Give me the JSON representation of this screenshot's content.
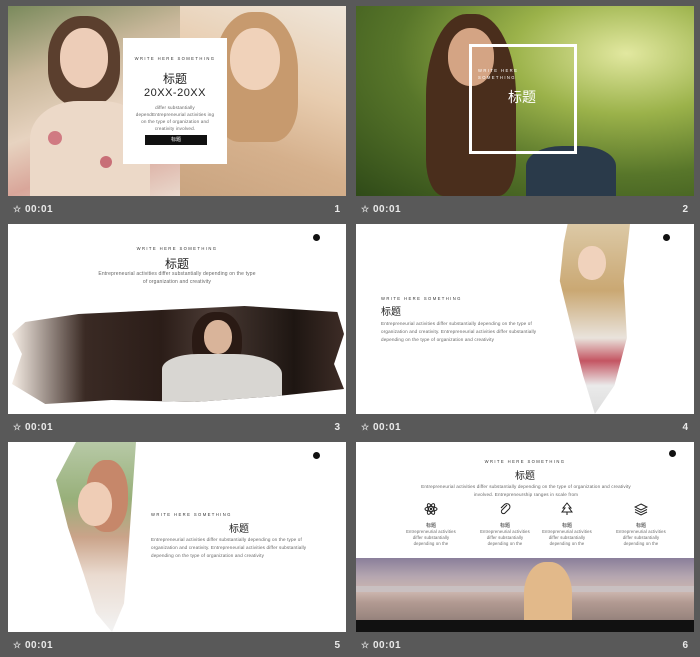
{
  "slides": [
    {
      "number": "1",
      "time": "00:01",
      "card": {
        "subtitle": "WRITE HERE SOMETHING",
        "title": "标题",
        "years": "20XX-20XX",
        "body": "differ substantially dependEntrepreneurial activities ing on the type of organization and creativity involved.",
        "button": "标题"
      }
    },
    {
      "number": "2",
      "time": "00:01",
      "overlay": {
        "subtitle": "WRITE HERE SOMETHING",
        "title": "标题"
      }
    },
    {
      "number": "3",
      "time": "00:01",
      "subtitle": "WRITE HERE SOMETHING",
      "title": "标题",
      "body": "Entrepreneurial activities differ substantially depending on the type of organization and creativity"
    },
    {
      "number": "4",
      "time": "00:01",
      "subtitle": "WRITE HERE SOMETHING",
      "title": "标题",
      "body": "Entrepreneurial activities differ substantially depending on the type of organization and creativity. Entrepreneurial activities differ substantially depending on the type of organization and creativity"
    },
    {
      "number": "5",
      "time": "00:01",
      "subtitle": "WRITE HERE SOMETHING",
      "title": "标题",
      "body": "Entrepreneurial activities differ substantially depending on the type of organization and creativity. Entrepreneurial activities differ substantially depending on the type of organization and creativity"
    },
    {
      "number": "6",
      "time": "00:01",
      "subtitle": "WRITE HERE SOMETHING",
      "title": "标题",
      "intro": "Entrepreneurial activities differ substantially depending on the type of organization and creativity involved. Entrepreneurship ranges in scale from",
      "features": [
        {
          "icon": "atom-icon",
          "label": "标题",
          "text": "Entrepreneurial activities differ substantially depending on the"
        },
        {
          "icon": "paperclip-icon",
          "label": "标题",
          "text": "Entrepreneurial activities differ substantially depending on the"
        },
        {
          "icon": "tree-icon",
          "label": "标题",
          "text": "Entrepreneurial activities differ substantially depending on the"
        },
        {
          "icon": "layers-icon",
          "label": "标题",
          "text": "Entrepreneurial activities differ substantially depending on the"
        }
      ]
    }
  ]
}
